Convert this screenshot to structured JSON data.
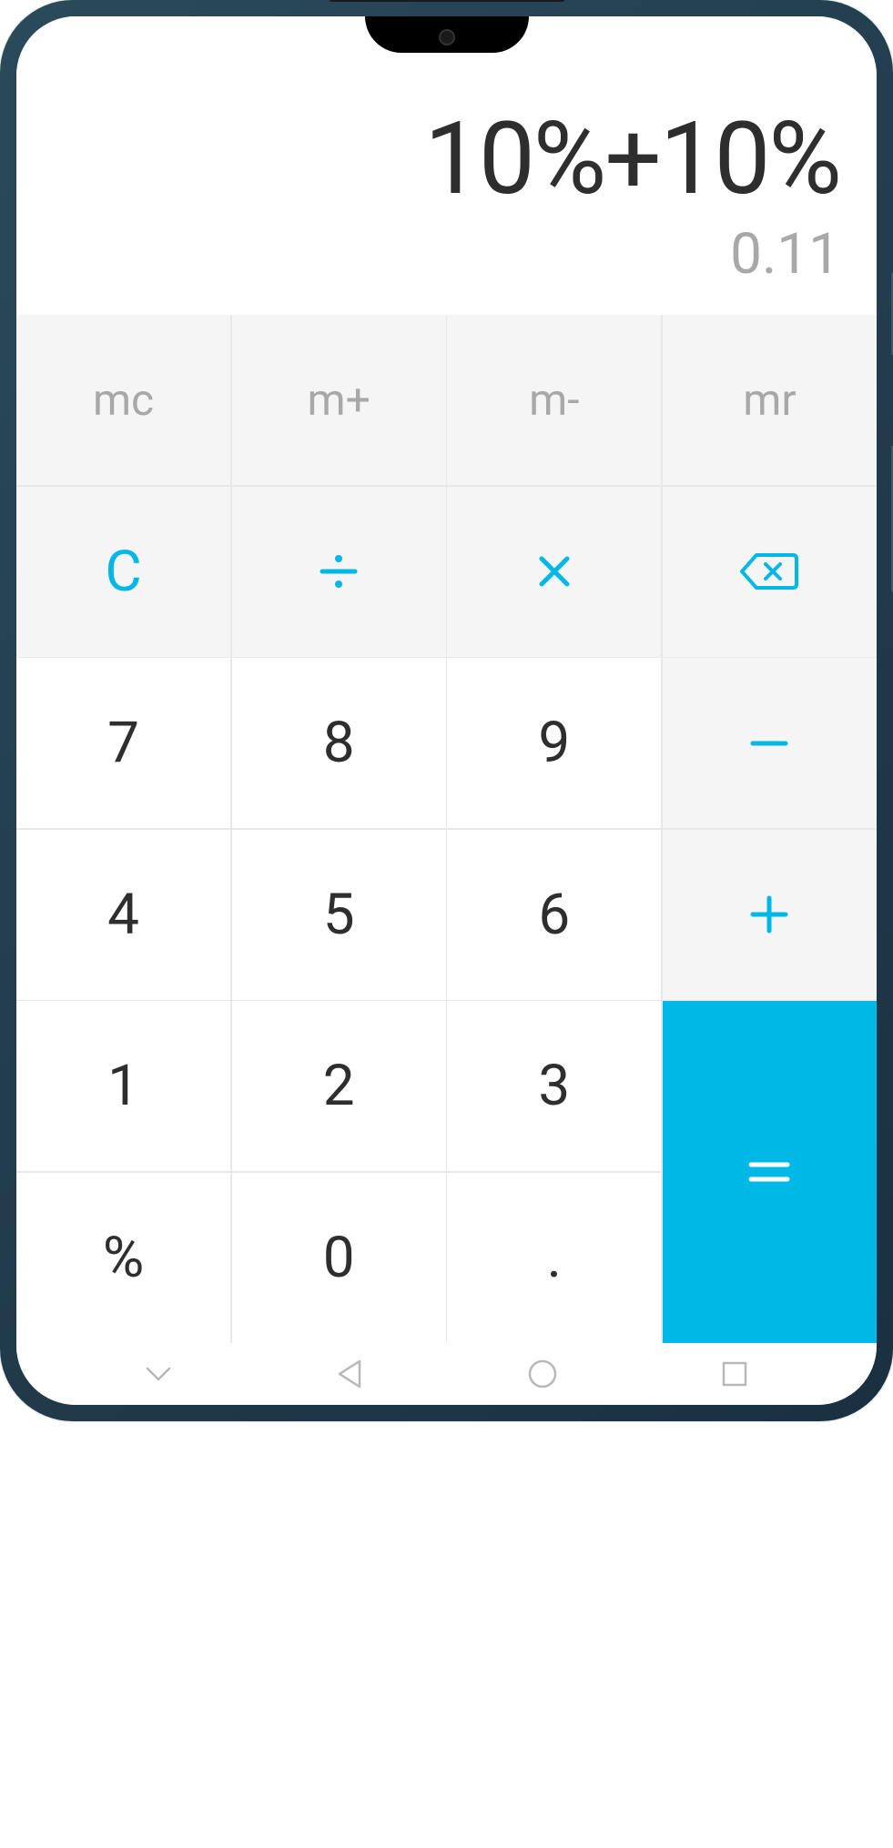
{
  "display": {
    "expression": "10%+10%",
    "result": "0.11"
  },
  "keypad": {
    "memory": [
      "mc",
      "m+",
      "m-",
      "mr"
    ],
    "clear": "C",
    "numbers": {
      "7": "7",
      "8": "8",
      "9": "9",
      "4": "4",
      "5": "5",
      "6": "6",
      "1": "1",
      "2": "2",
      "3": "3",
      "0": "0"
    },
    "percent": "%",
    "decimal": "."
  },
  "colors": {
    "accent": "#00b8e6",
    "text_dark": "#2e2e2e",
    "text_muted": "#a8a8a8",
    "key_light": "#f5f5f5",
    "key_white": "#ffffff"
  }
}
